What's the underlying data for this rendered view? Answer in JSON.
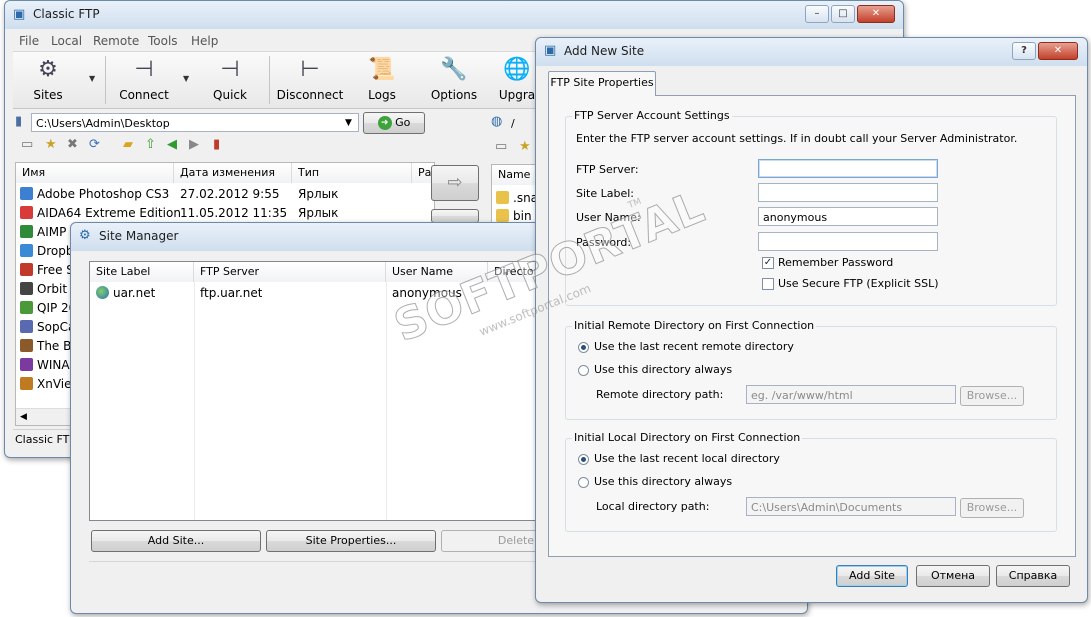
{
  "main_window": {
    "title": "Classic FTP",
    "menu": [
      "File",
      "Local",
      "Remote",
      "Tools",
      "Help"
    ],
    "toolbar": {
      "sites": "Sites",
      "connect": "Connect",
      "quick": "Quick",
      "disconnect": "Disconnect",
      "logs": "Logs",
      "options": "Options",
      "upgrade": "Upgra"
    },
    "local_path": "C:\\Users\\Admin\\Desktop",
    "go_label": "Go",
    "remote_path": "/",
    "local_columns": [
      "Имя",
      "Дата изменения",
      "Тип",
      "Ра"
    ],
    "local_files": [
      {
        "name": "Adobe Photoshop CS3",
        "date": "27.02.2012 9:55",
        "type": "Ярлык"
      },
      {
        "name": "AIDA64 Extreme Edition",
        "date": "11.05.2012 11:35",
        "type": "Ярлык"
      },
      {
        "name": "AIMP",
        "date": "",
        "type": ""
      },
      {
        "name": "Dropb",
        "date": "",
        "type": ""
      },
      {
        "name": "Free S",
        "date": "",
        "type": ""
      },
      {
        "name": "Orbit",
        "date": "",
        "type": ""
      },
      {
        "name": "QIP 20",
        "date": "",
        "type": ""
      },
      {
        "name": "SopCa",
        "date": "",
        "type": ""
      },
      {
        "name": "The Ba",
        "date": "",
        "type": ""
      },
      {
        "name": "WINA",
        "date": "",
        "type": ""
      },
      {
        "name": "XnView",
        "date": "",
        "type": ""
      }
    ],
    "remote_columns": [
      "Name"
    ],
    "remote_files": [
      ".snap",
      "bin"
    ],
    "status": "Classic FTP"
  },
  "site_manager": {
    "title": "Site Manager",
    "columns": [
      "Site Label",
      "FTP Server",
      "User Name",
      "Directory"
    ],
    "rows": [
      {
        "label": "uar.net",
        "server": "ftp.uar.net",
        "user": "anonymous"
      }
    ],
    "buttons": {
      "add": "Add Site...",
      "properties": "Site Properties...",
      "delete": "Delete"
    }
  },
  "add_site": {
    "title": "Add New Site",
    "help_btn": "?",
    "tab": "FTP Site Properties",
    "account_group": "FTP Server Account Settings",
    "account_hint": "Enter the FTP server account settings. If in doubt call your Server Administrator.",
    "labels": {
      "server": "FTP Server:",
      "site_label": "Site Label:",
      "user": "User Name:",
      "password": "Password:"
    },
    "values": {
      "server": "",
      "site_label": "",
      "user": "anonymous",
      "password": ""
    },
    "remember_password": "Remember Password",
    "secure_ftp": "Use Secure FTP (Explicit SSL)",
    "remote_group": "Initial Remote Directory on First Connection",
    "remote_opt1": "Use the last recent remote directory",
    "remote_opt2": "Use this directory always",
    "remote_path_label": "Remote directory path:",
    "remote_path_placeholder": "eg. /var/www/html",
    "local_group": "Initial Local Directory on First Connection",
    "local_opt1": "Use the last recent local directory",
    "local_opt2": "Use this directory always",
    "local_path_label": "Local directory path:",
    "local_path_value": "C:\\Users\\Admin\\Documents",
    "browse": "Browse...",
    "buttons": {
      "add": "Add Site",
      "cancel": "Отмена",
      "help": "Справка"
    }
  },
  "watermark": {
    "brand": "SOFTPORTAL",
    "url": "www.softportal.com",
    "tm": "TM"
  }
}
